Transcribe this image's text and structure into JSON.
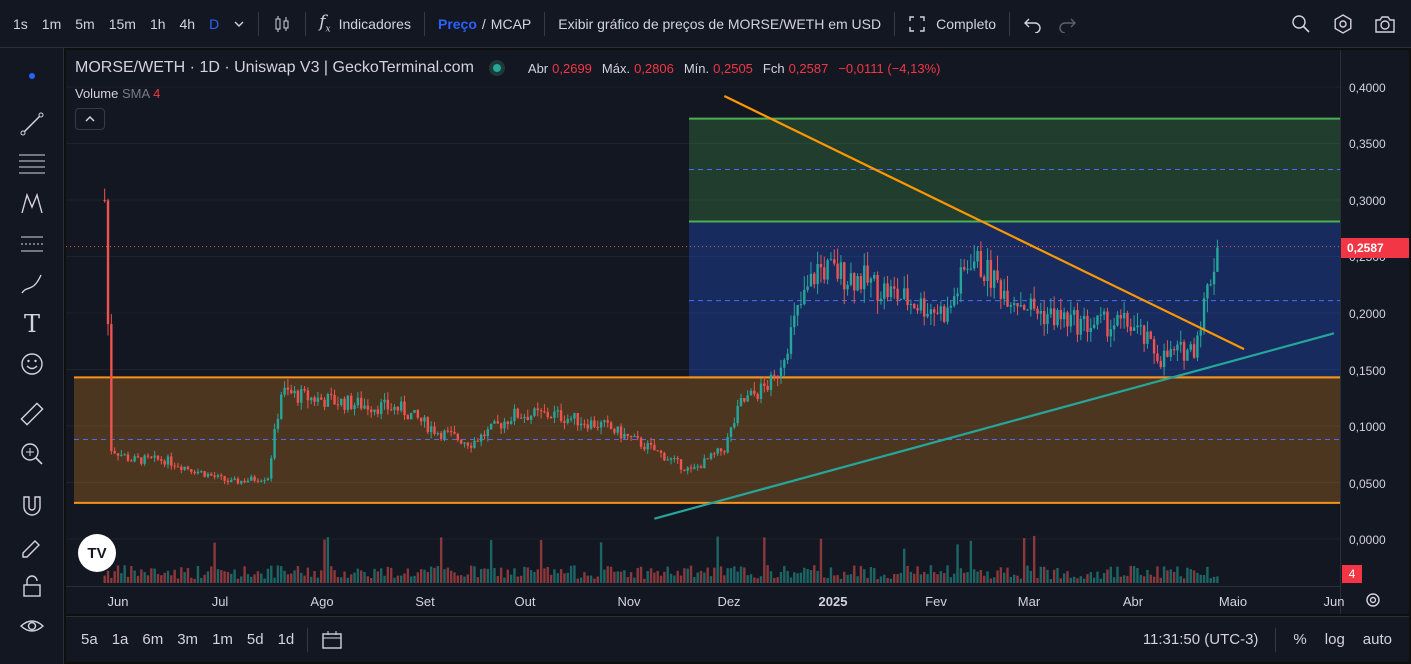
{
  "top_bar": {
    "intervals": [
      "1s",
      "1m",
      "5m",
      "15m",
      "1h",
      "4h",
      "D"
    ],
    "active_interval": "D",
    "indicators_label": "Indicadores",
    "price_label": "Preço",
    "slash": "/",
    "mcap_label": "MCAP",
    "usd_toggle_label": "Exibir gráfico de preços de MORSE/WETH em USD",
    "fullscreen_label": "Completo"
  },
  "legend": {
    "title": "MORSE/WETH · 1D · Uniswap V3 | GeckoTerminal.com",
    "open_label": "Abr",
    "open": "0,2699",
    "high_label": "Máx.",
    "high": "0,2806",
    "low_label": "Mín.",
    "low": "0,2505",
    "close_label": "Fch",
    "close": "0,2587",
    "change": "−0,0111 (−4,13%)",
    "volume_label": "Volume",
    "sma_label": "SMA",
    "sma_period": "4"
  },
  "price_scale": {
    "ticks": [
      "0,4000",
      "0,3500",
      "0,3000",
      "0,2500",
      "0,2000",
      "0,1500",
      "0,1000",
      "0,0500",
      "0,0000"
    ],
    "last_price": "0,2587",
    "volume_badge": "4"
  },
  "time_axis": {
    "labels": [
      "Jun",
      "Jul",
      "Ago",
      "Set",
      "Out",
      "Nov",
      "Dez",
      "2025",
      "Fev",
      "Mar",
      "Abr",
      "Maio",
      "Jun"
    ]
  },
  "bottom_bar": {
    "ranges": [
      "5a",
      "1a",
      "6m",
      "3m",
      "1m",
      "5d",
      "1d"
    ],
    "time": "11:31:50 (UTC-3)",
    "percent_label": "%",
    "log_label": "log",
    "auto_label": "auto"
  },
  "colors": {
    "up": "#26a69a",
    "down": "#ef5350",
    "accent": "#2962ff",
    "orange_zone": "#f7931a",
    "blue_zone": "#2962ff",
    "green_zone": "#4caf50",
    "trendline_down": "#ff9800",
    "trendline_up": "#26a69a"
  },
  "chart_data": {
    "type": "candlestick",
    "symbol": "MORSE/WETH",
    "timeframe": "1D",
    "ylim": [
      0,
      0.4
    ],
    "zones": [
      {
        "from": 0.032,
        "to": 0.143,
        "mid": 0.088,
        "color": "orange"
      },
      {
        "from": 0.143,
        "to": 0.281,
        "mid": 0.211,
        "color": "blue"
      },
      {
        "from": 0.281,
        "to": 0.372,
        "mid": 0.327,
        "color": "green"
      }
    ],
    "trendlines": [
      {
        "name": "resistance",
        "from": [
          "2024-11-30",
          0.392
        ],
        "to": [
          "2025-05-05",
          0.168
        ]
      },
      {
        "name": "support",
        "from": [
          "2024-11-09",
          0.018
        ],
        "to": [
          "2025-06-01",
          0.182
        ]
      }
    ],
    "close_path": [
      [
        "2024-05-28",
        0.3
      ],
      [
        "2024-05-30",
        0.08
      ],
      [
        "2024-06-05",
        0.07
      ],
      [
        "2024-06-15",
        0.07
      ],
      [
        "2024-06-25",
        0.06
      ],
      [
        "2024-07-05",
        0.05
      ],
      [
        "2024-07-16",
        0.055
      ],
      [
        "2024-07-20",
        0.13
      ],
      [
        "2024-07-28",
        0.125
      ],
      [
        "2024-08-10",
        0.12
      ],
      [
        "2024-08-25",
        0.115
      ],
      [
        "2024-09-05",
        0.095
      ],
      [
        "2024-09-15",
        0.085
      ],
      [
        "2024-09-28",
        0.11
      ],
      [
        "2024-10-10",
        0.11
      ],
      [
        "2024-10-25",
        0.1
      ],
      [
        "2024-11-08",
        0.08
      ],
      [
        "2024-11-20",
        0.06
      ],
      [
        "2024-11-30",
        0.08
      ],
      [
        "2024-12-05",
        0.12
      ],
      [
        "2024-12-15",
        0.14
      ],
      [
        "2024-12-22",
        0.2
      ],
      [
        "2024-12-28",
        0.24
      ],
      [
        "2025-01-10",
        0.23
      ],
      [
        "2025-01-25",
        0.21
      ],
      [
        "2025-02-05",
        0.2
      ],
      [
        "2025-02-12",
        0.25
      ],
      [
        "2025-02-22",
        0.22
      ],
      [
        "2025-03-05",
        0.2
      ],
      [
        "2025-03-18",
        0.19
      ],
      [
        "2025-04-01",
        0.19
      ],
      [
        "2025-04-10",
        0.16
      ],
      [
        "2025-04-20",
        0.17
      ],
      [
        "2025-04-24",
        0.22
      ],
      [
        "2025-04-27",
        0.2587
      ]
    ]
  }
}
